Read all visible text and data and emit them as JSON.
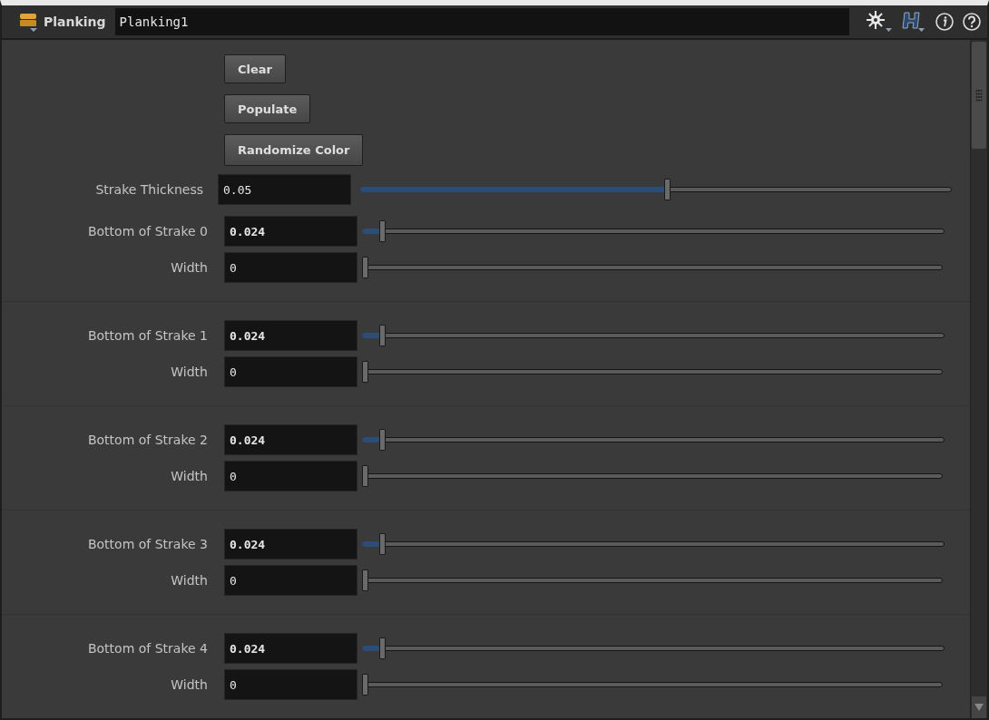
{
  "header": {
    "node_type": "Planking",
    "node_name": "Planking1"
  },
  "buttons": [
    "Clear",
    "Populate",
    "Randomize Color"
  ],
  "thickness": {
    "label": "Strake Thickness",
    "value": "0.05",
    "level": 0.52
  },
  "strakes": [
    {
      "bottom": {
        "label": "Bottom of Strake 0",
        "value": "0.024",
        "level": 0.03
      },
      "width": {
        "label": "Width",
        "value": "0",
        "level": 0
      }
    },
    {
      "bottom": {
        "label": "Bottom of Strake 1",
        "value": "0.024",
        "level": 0.03
      },
      "width": {
        "label": "Width",
        "value": "0",
        "level": 0
      }
    },
    {
      "bottom": {
        "label": "Bottom of Strake 2",
        "value": "0.024",
        "level": 0.03
      },
      "width": {
        "label": "Width",
        "value": "0",
        "level": 0
      }
    },
    {
      "bottom": {
        "label": "Bottom of Strake 3",
        "value": "0.024",
        "level": 0.03
      },
      "width": {
        "label": "Width",
        "value": "0",
        "level": 0
      }
    },
    {
      "bottom": {
        "label": "Bottom of Strake 4",
        "value": "0.024",
        "level": 0.03
      },
      "width": {
        "label": "Width",
        "value": "0",
        "level": 0
      }
    }
  ]
}
